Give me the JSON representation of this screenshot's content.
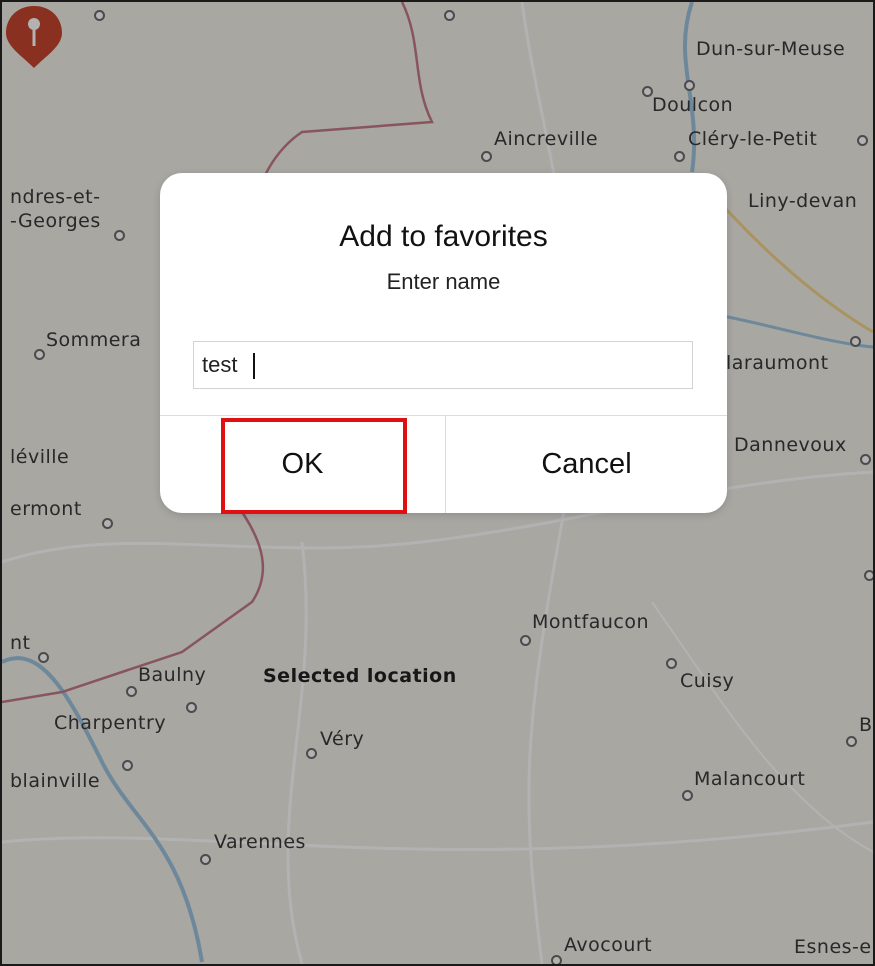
{
  "map": {
    "places": [
      {
        "name": "Dun-sur-Meuse"
      },
      {
        "name": "Doulcon"
      },
      {
        "name": "Aincreville"
      },
      {
        "name": "Cléry-le-Petit"
      },
      {
        "name": "ndres-et-"
      },
      {
        "name": "-Georges"
      },
      {
        "name": "Liny-devan"
      },
      {
        "name": "Sommera"
      },
      {
        "name": "laraumont"
      },
      {
        "name": "léville"
      },
      {
        "name": "Dannevoux"
      },
      {
        "name": "ermont"
      },
      {
        "name": "Montfaucon"
      },
      {
        "name": "nt"
      },
      {
        "name": "Baulny"
      },
      {
        "name": "Cuisy"
      },
      {
        "name": "Charpentry"
      },
      {
        "name": "Véry"
      },
      {
        "name": "B"
      },
      {
        "name": "blainville"
      },
      {
        "name": "Malancourt"
      },
      {
        "name": "Varennes"
      },
      {
        "name": "Avocourt"
      },
      {
        "name": "Esnes-e"
      }
    ],
    "selected_label": "Selected location",
    "pin_color": "#c6452f"
  },
  "dialog": {
    "title": "Add to favorites",
    "message": "Enter name",
    "input_value": "test",
    "ok_label": "OK",
    "cancel_label": "Cancel"
  },
  "highlight_color": "#e01010"
}
